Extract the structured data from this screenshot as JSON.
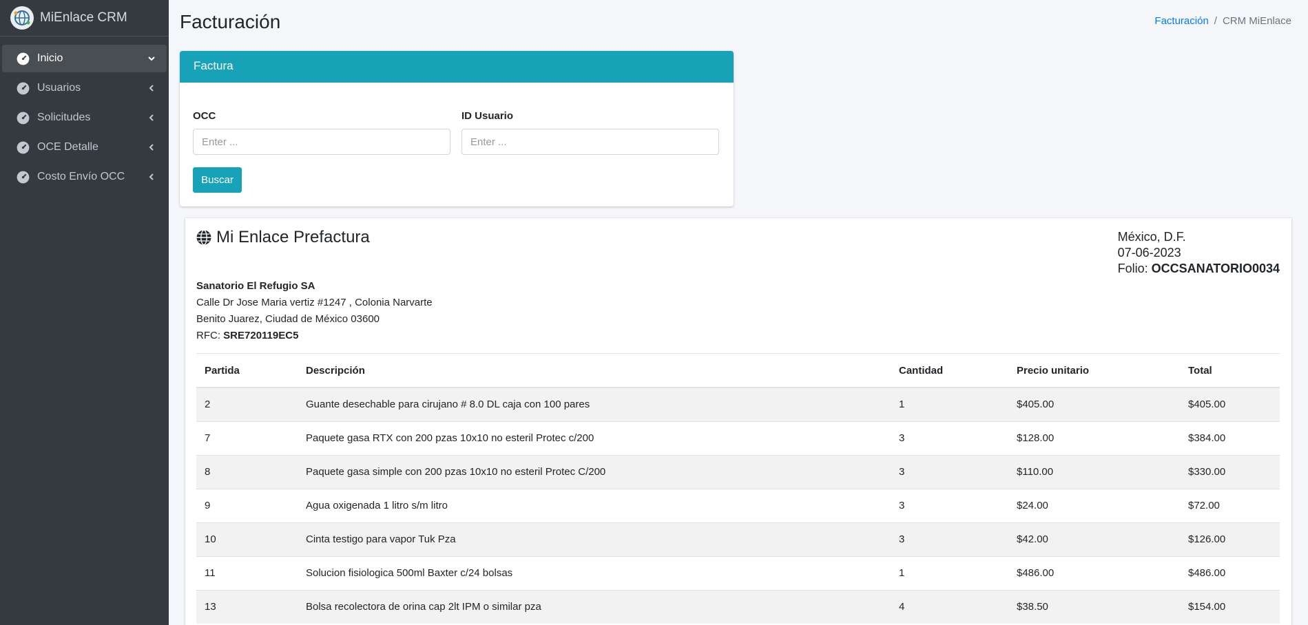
{
  "brand": {
    "name": "MiEnlace CRM",
    "logo_icon": "globe-network-icon"
  },
  "sidebar": {
    "items": [
      {
        "label": "Inicio",
        "icon": "tachometer-icon",
        "active": true,
        "chevron": "chevron-down-icon"
      },
      {
        "label": "Usuarios",
        "icon": "tachometer-icon",
        "chevron": "chevron-left-icon"
      },
      {
        "label": "Solicitudes",
        "icon": "tachometer-icon",
        "chevron": "chevron-left-icon"
      },
      {
        "label": "OCE Detalle",
        "icon": "tachometer-icon",
        "chevron": "chevron-left-icon"
      },
      {
        "label": "Costo Envío OCC",
        "icon": "tachometer-icon",
        "chevron": "chevron-left-icon"
      }
    ]
  },
  "header": {
    "title": "Facturación",
    "breadcrumb": {
      "link": "Facturación",
      "separator": "/",
      "current": "CRM MiEnlace"
    }
  },
  "search_card": {
    "title": "Factura",
    "occ": {
      "label": "OCC",
      "placeholder": "Enter ...",
      "value": ""
    },
    "user_id": {
      "label": "ID Usuario",
      "placeholder": "Enter ...",
      "value": ""
    },
    "button_label": "Buscar"
  },
  "invoice": {
    "title": "Mi Enlace Prefactura",
    "location": "México, D.F.",
    "date": "07-06-2023",
    "folio_label": "Folio:",
    "folio": "OCCSANATORIO0034",
    "client": {
      "name": "Sanatorio El Refugio SA",
      "address1": "Calle Dr Jose Maria vertiz #1247 , Colonia Narvarte",
      "address2": "Benito Juarez, Ciudad de México 03600",
      "rfc_label": "RFC:",
      "rfc": "SRE720119EC5"
    },
    "columns": [
      "Partida",
      "Descripción",
      "Cantidad",
      "Precio unitario",
      "Total"
    ],
    "rows": [
      [
        "2",
        "Guante desechable para cirujano # 8.0 DL caja con 100 pares",
        "1",
        "$405.00",
        "$405.00"
      ],
      [
        "7",
        "Paquete gasa RTX con 200 pzas 10x10 no esteril Protec c/200",
        "3",
        "$128.00",
        "$384.00"
      ],
      [
        "8",
        "Paquete gasa simple con 200 pzas 10x10 no esteril Protec C/200",
        "3",
        "$110.00",
        "$330.00"
      ],
      [
        "9",
        "Agua oxigenada 1 litro s/m litro",
        "3",
        "$24.00",
        "$72.00"
      ],
      [
        "10",
        "Cinta testigo para vapor Tuk Pza",
        "3",
        "$42.00",
        "$126.00"
      ],
      [
        "11",
        "Solucion fisiologica 500ml Baxter c/24 bolsas",
        "1",
        "$486.00",
        "$486.00"
      ],
      [
        "13",
        "Bolsa recolectora de orina cap 2lt IPM o similar pza",
        "4",
        "$38.50",
        "$154.00"
      ]
    ]
  },
  "colors": {
    "sidebar_bg": "#343a40",
    "accent": "#17a2b8",
    "link": "#007bff",
    "page_bg": "#f4f6f9"
  }
}
